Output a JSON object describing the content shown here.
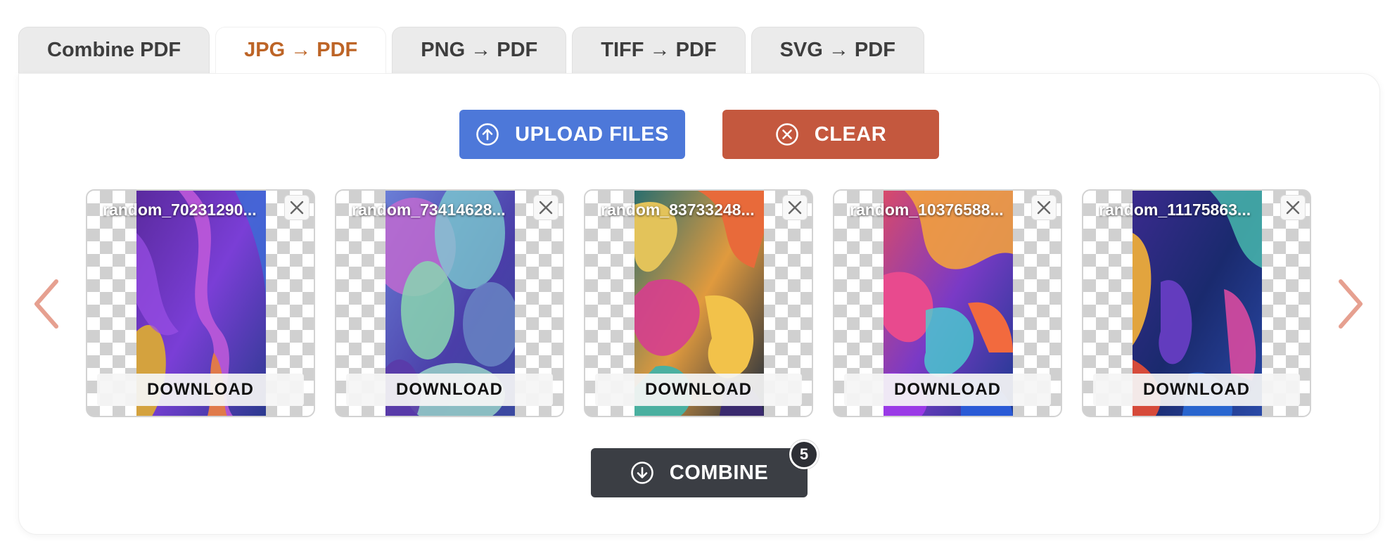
{
  "tabs": [
    {
      "label": "Combine PDF",
      "active": false
    },
    {
      "label": "JPG → PDF",
      "active": true
    },
    {
      "label": "PNG → PDF",
      "active": false
    },
    {
      "label": "TIFF → PDF",
      "active": false
    },
    {
      "label": "SVG → PDF",
      "active": false
    }
  ],
  "actions": {
    "upload_label": "UPLOAD FILES",
    "upload_icon": "upload-circle-icon",
    "clear_label": "CLEAR",
    "clear_icon": "clear-circle-icon",
    "combine_label": "COMBINE",
    "combine_icon": "download-circle-icon",
    "combine_count": "5"
  },
  "files": [
    {
      "name": "random_70231290...",
      "download_label": "DOWNLOAD"
    },
    {
      "name": "random_73414628...",
      "download_label": "DOWNLOAD"
    },
    {
      "name": "random_83733248...",
      "download_label": "DOWNLOAD"
    },
    {
      "name": "random_10376588...",
      "download_label": "DOWNLOAD"
    },
    {
      "name": "random_11175863...",
      "download_label": "DOWNLOAD"
    }
  ],
  "colors": {
    "active_tab_text": "#bd6426",
    "upload_button": "#4d78d9",
    "clear_button": "#c4583e",
    "combine_button": "#3b3e44",
    "carousel_arrow": "#e6a090"
  }
}
